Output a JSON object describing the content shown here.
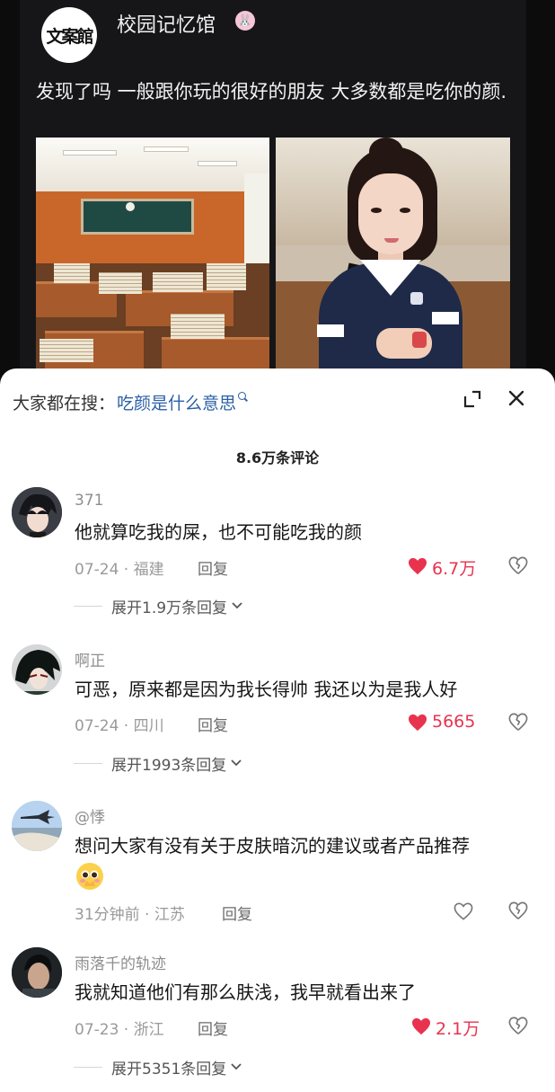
{
  "post": {
    "logo_text": "文案館",
    "author": "校园记忆馆",
    "author_badge_icon": "rabbit-icon",
    "text": "发现了吗 一般跟你玩的很好的朋友 大多数都是吃你的颜."
  },
  "search": {
    "prefix": "大家都在搜：",
    "query": "吃颜是什么意思"
  },
  "comment_count": "8.6万条评论",
  "comments": [
    {
      "username": "371",
      "text": "他就算吃我的屎，也不可能吃我的颜",
      "date": "07-24",
      "location": "福建",
      "reply_label": "回复",
      "likes": "6.7万",
      "liked": true,
      "expand": "展开1.9万条回复"
    },
    {
      "username": "啊正",
      "text": "可恶，原来都是因为我长得帅  我还以为是我人好",
      "date": "07-24",
      "location": "四川",
      "reply_label": "回复",
      "likes": "5665",
      "liked": true,
      "expand": "展开1993条回复"
    },
    {
      "username": "@悸",
      "text": "想问大家有没有关于皮肤暗沉的建议或者产品推荐",
      "date": "31分钟前",
      "location": "江苏",
      "reply_label": "回复",
      "likes": "",
      "liked": false,
      "expand": ""
    },
    {
      "username": "雨落千的轨迹",
      "text": "我就知道他们有那么肤浅，我早就看出来了",
      "date": "07-23",
      "location": "浙江",
      "reply_label": "回复",
      "likes": "2.1万",
      "liked": true,
      "expand": "展开5351条回复"
    }
  ],
  "colors": {
    "like": "#e8334f",
    "link": "#2b5fa6",
    "post_bg": "#161618"
  }
}
